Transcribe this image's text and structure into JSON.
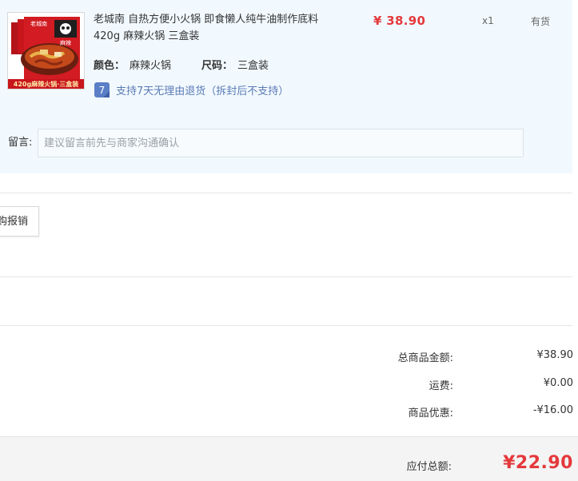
{
  "item": {
    "title": "老城南 自热方便小火锅 即食懒人纯牛油制作底料420g 麻辣火锅 三盒装",
    "price": "¥ 38.90",
    "quantity": "x1",
    "stock": "有货",
    "color_label": "颜色：",
    "color_value": "麻辣火锅",
    "size_label": "尺码：",
    "size_value": "三盒装",
    "return_badge": "7",
    "return_text": "支持7天无理由退货（拆封后不支持）",
    "thumb_caption": "420g麻辣火锅·三盒装",
    "thumb_brand": "老城南",
    "thumb_panel": "麻辣"
  },
  "message": {
    "label": "留言:",
    "placeholder": "建议留言前先与商家沟通确认"
  },
  "invoice": {
    "button_label": "购报销"
  },
  "summary": {
    "goods_total_label": "总商品金额:",
    "goods_total_value": "¥38.90",
    "shipping_label": "运费:",
    "shipping_value": "¥0.00",
    "discount_label": "商品优惠:",
    "discount_value": "-¥16.00"
  },
  "total": {
    "label": "应付总额:",
    "value": "¥22.90"
  },
  "colors": {
    "price_red": "#e4393c",
    "panel_bg": "#f2f9fe",
    "link_blue": "#5a7bb5",
    "badge_blue": "#5b7fc7"
  }
}
